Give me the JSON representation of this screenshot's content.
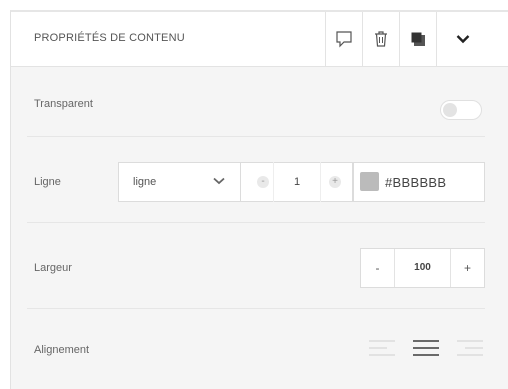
{
  "header": {
    "title": "PROPRIÉTÉS DE CONTENU",
    "buttons": [
      "comment-icon",
      "trash-icon",
      "duplicate-icon",
      "chevron-down-icon"
    ]
  },
  "transparent": {
    "label": "Transparent",
    "enabled": false
  },
  "ligne": {
    "label": "Ligne",
    "style_value": "ligne",
    "stepper": {
      "minus": "-",
      "value": "1",
      "plus": "+"
    },
    "color": {
      "swatch": "#BBBBBB",
      "value": "#BBBBBB"
    }
  },
  "largeur": {
    "label": "Largeur",
    "minus": "-",
    "value": "100",
    "plus": "+"
  },
  "alignement": {
    "label": "Alignement",
    "options": [
      "left",
      "center",
      "right"
    ],
    "selected": "center"
  }
}
